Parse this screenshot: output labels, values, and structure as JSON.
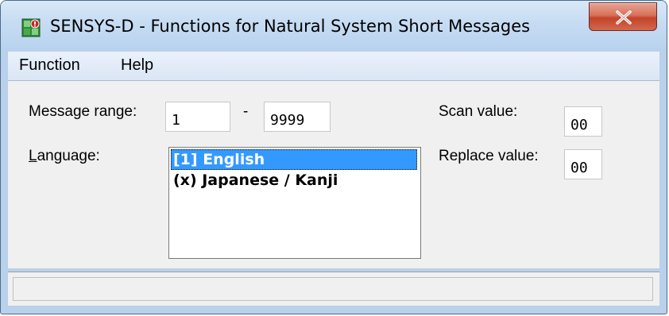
{
  "window": {
    "title": "SENSYS-D - Functions  for Natural System Short Messages",
    "icon": "app-icon",
    "close_icon": "close-icon"
  },
  "menu": {
    "items": [
      {
        "label": "Function"
      },
      {
        "label": "Help"
      }
    ]
  },
  "form": {
    "message_range": {
      "label": "Message range:",
      "from": "1",
      "separator": "-",
      "to": "9999"
    },
    "language": {
      "label_first": "L",
      "label_rest": "anguage:",
      "items": [
        {
          "label": "[1] English",
          "selected": true
        },
        {
          "label": "(x) Japanese / Kanji",
          "selected": false
        }
      ]
    },
    "scan_value": {
      "label": "Scan value:",
      "value": "00"
    },
    "replace_value": {
      "label": "Replace value:",
      "value": "00"
    }
  },
  "status": {
    "text": ""
  },
  "colors": {
    "selection": "#3399ff",
    "client_bg": "#f0f0f0",
    "frame": "#b9d1ea"
  }
}
